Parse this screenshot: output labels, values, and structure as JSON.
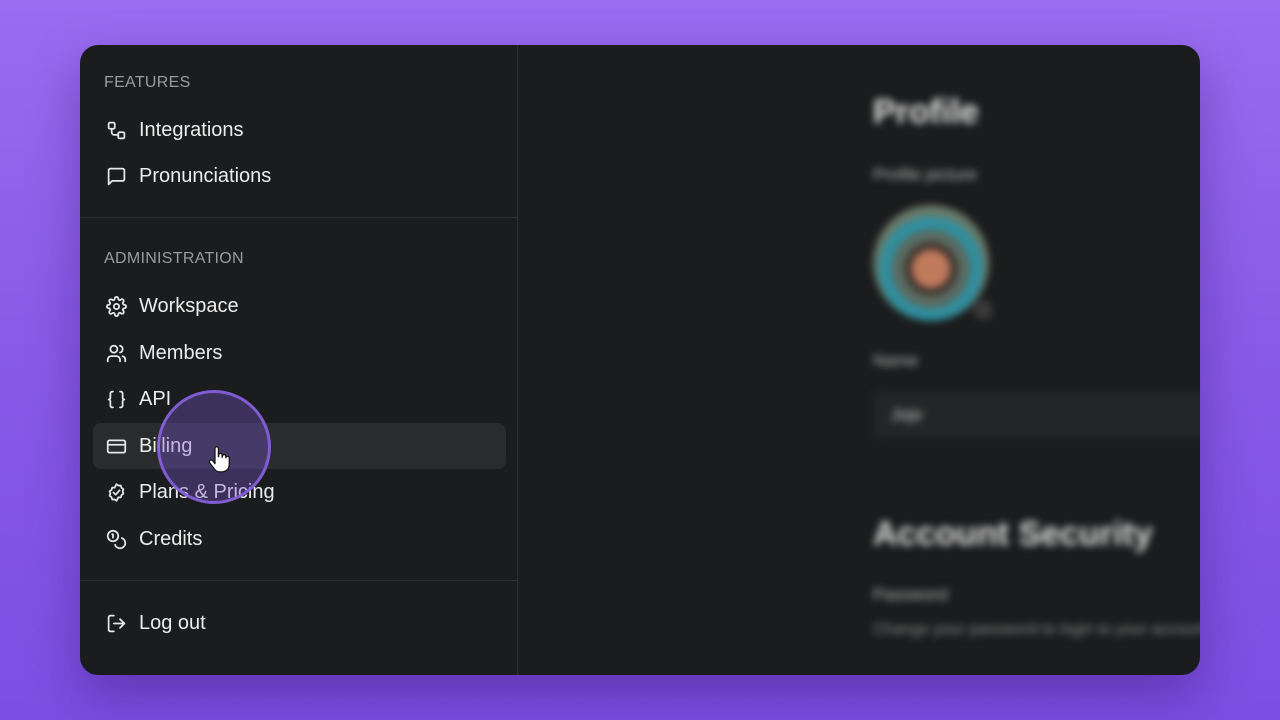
{
  "sidebar": {
    "features": {
      "label": "FEATURES",
      "items": [
        {
          "label": "Integrations",
          "icon": "integrations-icon"
        },
        {
          "label": "Pronunciations",
          "icon": "message-square-icon"
        }
      ]
    },
    "administration": {
      "label": "ADMINISTRATION",
      "items": [
        {
          "label": "Workspace",
          "icon": "gear-icon"
        },
        {
          "label": "Members",
          "icon": "users-icon"
        },
        {
          "label": "API",
          "icon": "braces-icon"
        },
        {
          "label": "Billing",
          "icon": "credit-card-icon",
          "active": true
        },
        {
          "label": "Plans & Pricing",
          "icon": "badge-check-icon"
        },
        {
          "label": "Credits",
          "icon": "coins-icon"
        }
      ]
    },
    "logout": {
      "label": "Log out",
      "icon": "log-out-icon"
    }
  },
  "main": {
    "profile_title": "Profile",
    "profile_picture_label": "Profile picture",
    "name_label": "Name",
    "name_value": "Jojo",
    "security_title": "Account Security",
    "password_label": "Password",
    "password_description": "Change your password to login to your account."
  },
  "colors": {
    "background": "#8a5be8",
    "window": "#1b1c1d",
    "active_item": "#2a2b2d",
    "cursor_ring": "#8862e0"
  }
}
